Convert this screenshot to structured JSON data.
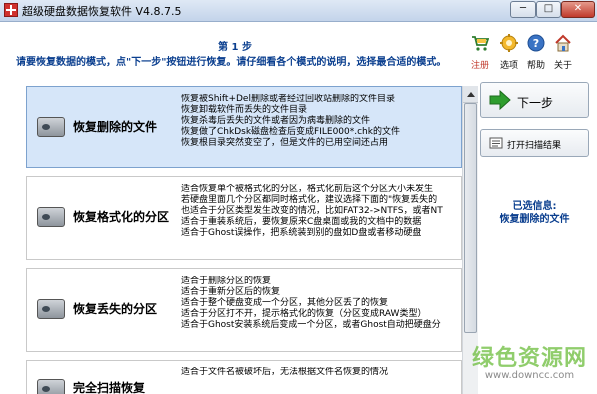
{
  "window": {
    "title": "超级硬盘数据恢复软件 V4.8.7.5",
    "minimize_glyph": "─",
    "maximize_glyph": "□",
    "close_glyph": "✕"
  },
  "header": {
    "step_title": "第 1 步",
    "step_desc": "请要恢复数据的模式，点\"下一步\"按钮进行恢复。请仔细看各个模式的说明，选择最合适的模式。"
  },
  "toolbar": [
    {
      "label": "注册",
      "icon": "cart-icon"
    },
    {
      "label": "选项",
      "icon": "gear-icon"
    },
    {
      "label": "帮助",
      "icon": "help-icon"
    },
    {
      "label": "关于",
      "icon": "house-icon"
    }
  ],
  "modes": [
    {
      "name": "恢复删除的文件",
      "selected": true,
      "lines": [
        "恢复被Shift+Del删除或者经过回收站删除的文件目录",
        "恢复卸载软件而丢失的文件目录",
        "恢复杀毒后丢失的文件或者因为病毒删除的文件",
        "恢复做了ChkDsk磁盘检查后变成FILE000*.chk的文件",
        "恢复根目录突然变空了，但是文件的已用空间还占用"
      ]
    },
    {
      "name": "恢复格式化的分区",
      "selected": false,
      "lines": [
        "适合恢复单个被格式化的分区，格式化前后这个分区大小未发生",
        "若硬盘里面几个分区都同时格式化，建议选择下面的\"恢复丢失的",
        "也适合于分区类型发生改变的情况，比如FAT32->NTFS，或者NT",
        "适合于重装系统后，要恢复原来C盘桌面或我的文档中的数据",
        "适合于Ghost误操作，把系统装到别的盘如D盘或者移动硬盘"
      ]
    },
    {
      "name": "恢复丢失的分区",
      "selected": false,
      "lines": [
        "适合于删除分区的恢复",
        "适合于重新分区后的恢复",
        "适合于整个硬盘变成一个分区，其他分区丢了的恢复",
        "适合于分区打不开，提示格式化的恢复（分区变成RAW类型）",
        "适合于Ghost安装系统后变成一个分区，或者Ghost自动把硬盘分"
      ]
    },
    {
      "name": "完全扫描恢复",
      "selected": false,
      "lines": [
        "适合于文件名被破坏后，无法根据文件名恢复的情况"
      ]
    }
  ],
  "actions": {
    "next_label": "下一步",
    "open_label": "打开扫描结果"
  },
  "selection": {
    "caption": "已选信息:",
    "value": "恢复删除的文件"
  },
  "watermark": {
    "main": "绿色资源网",
    "sub": "www.downcc.com"
  },
  "colors": {
    "accent": "#0b3f8f",
    "selected_row": "#d6e6f9",
    "next_arrow": "#2e9d2e"
  }
}
